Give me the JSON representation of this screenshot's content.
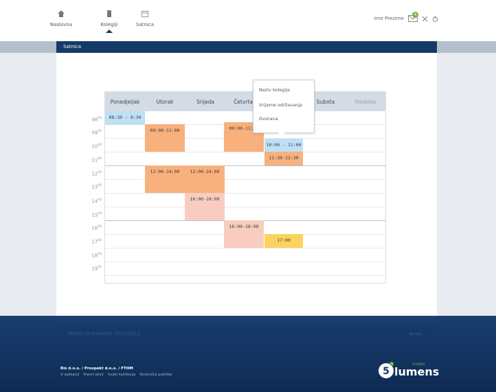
{
  "nav": {
    "items": [
      {
        "label": "Naslovna",
        "icon": "home-icon"
      },
      {
        "label": "Kolegiji",
        "icon": "book-icon"
      },
      {
        "label": "Satnica",
        "icon": "calendar-icon"
      }
    ],
    "active": "Kolegiji"
  },
  "user": {
    "name": "Ime Prezime",
    "notifications": "4"
  },
  "subbar": {
    "title": "Satnica"
  },
  "calendar": {
    "days": [
      "Ponedjeljak",
      "Utorak",
      "Srijeda",
      "Četvrta",
      "",
      "Subota",
      "Nedjelja"
    ],
    "hours": [
      "08",
      "09",
      "10",
      "11",
      "12",
      "13",
      "14",
      "15",
      "16",
      "17",
      "18",
      "19"
    ],
    "hour_suffix": "00",
    "events": [
      {
        "day": "Ponedjeljak",
        "label": "08:30 - 8:30",
        "color": "blue"
      },
      {
        "day": "Utorak",
        "label": "09:00-11:00",
        "color": "orange"
      },
      {
        "day": "Četvrtak",
        "label": "09:00-11:00",
        "color": "orange"
      },
      {
        "day": "Petak",
        "label": "10:00 - 11:00",
        "color": "blue"
      },
      {
        "day": "Petak",
        "label": "11:30-12:30",
        "color": "orange"
      },
      {
        "day": "Utorak",
        "label": "12:00-14:00",
        "color": "orange"
      },
      {
        "day": "Srijeda",
        "label": "12:00-14:00",
        "color": "orange"
      },
      {
        "day": "Srijeda",
        "label": "16:00-18:00",
        "color": "pink"
      },
      {
        "day": "Četvrtak",
        "label": "16:00-18:00",
        "color": "pink"
      },
      {
        "day": "Petak",
        "label": "17:00",
        "color": "yellow"
      }
    ]
  },
  "popup": {
    "items": [
      "Naziv kolegija",
      "Vrijeme održavanja",
      "Dvorana"
    ]
  },
  "footer": {
    "portal": "Portal za studente 2012/2013",
    "right_link": "Ro učli",
    "company": "Ris d.o.o. / Prospekt d.o.o. / FTHM",
    "links": [
      "O aplikaciji",
      "Pravni okvir",
      "Uvjeti korištenja",
      "Korisnička podrška"
    ],
    "logo_text": "lumens",
    "logo_sup": "STUDENT"
  },
  "colors": {
    "navy": "#143a68",
    "blue_event": "#bfe0f4",
    "orange_event": "#f8b07d",
    "pink_event": "#f8cdc0",
    "yellow_event": "#fbd35e",
    "badge": "#7ab648"
  }
}
